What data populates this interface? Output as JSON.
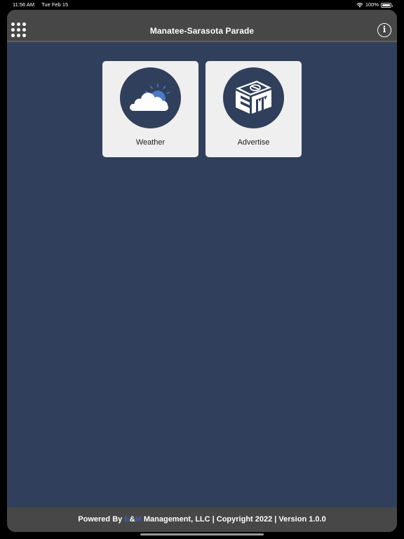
{
  "status_bar": {
    "time": "11:56 AM",
    "date": "Tue Feb 15",
    "battery": "100%",
    "wifi_icon": "wifi-icon",
    "battery_icon": "battery-icon"
  },
  "nav": {
    "title": "Manatee-Sarasota Parade",
    "menu_icon": "grid-menu-icon",
    "info_icon": "info-icon",
    "info_glyph": "i"
  },
  "tiles": [
    {
      "label": "Weather",
      "icon": "weather-cloud-sun-icon"
    },
    {
      "label": "Advertise",
      "icon": "em-logo-icon"
    }
  ],
  "footer": {
    "prefix": "Powered By ",
    "brand_e": "E",
    "brand_amp": "&",
    "brand_m": "M",
    "suffix": " Management, LLC | Copyright 2022 | Version 1.0.0"
  },
  "colors": {
    "background": "#303f5b",
    "nav_bar": "#474747",
    "tile": "#efefef",
    "brand_blue": "#3e5fa6",
    "sun": "#4a79c6"
  }
}
